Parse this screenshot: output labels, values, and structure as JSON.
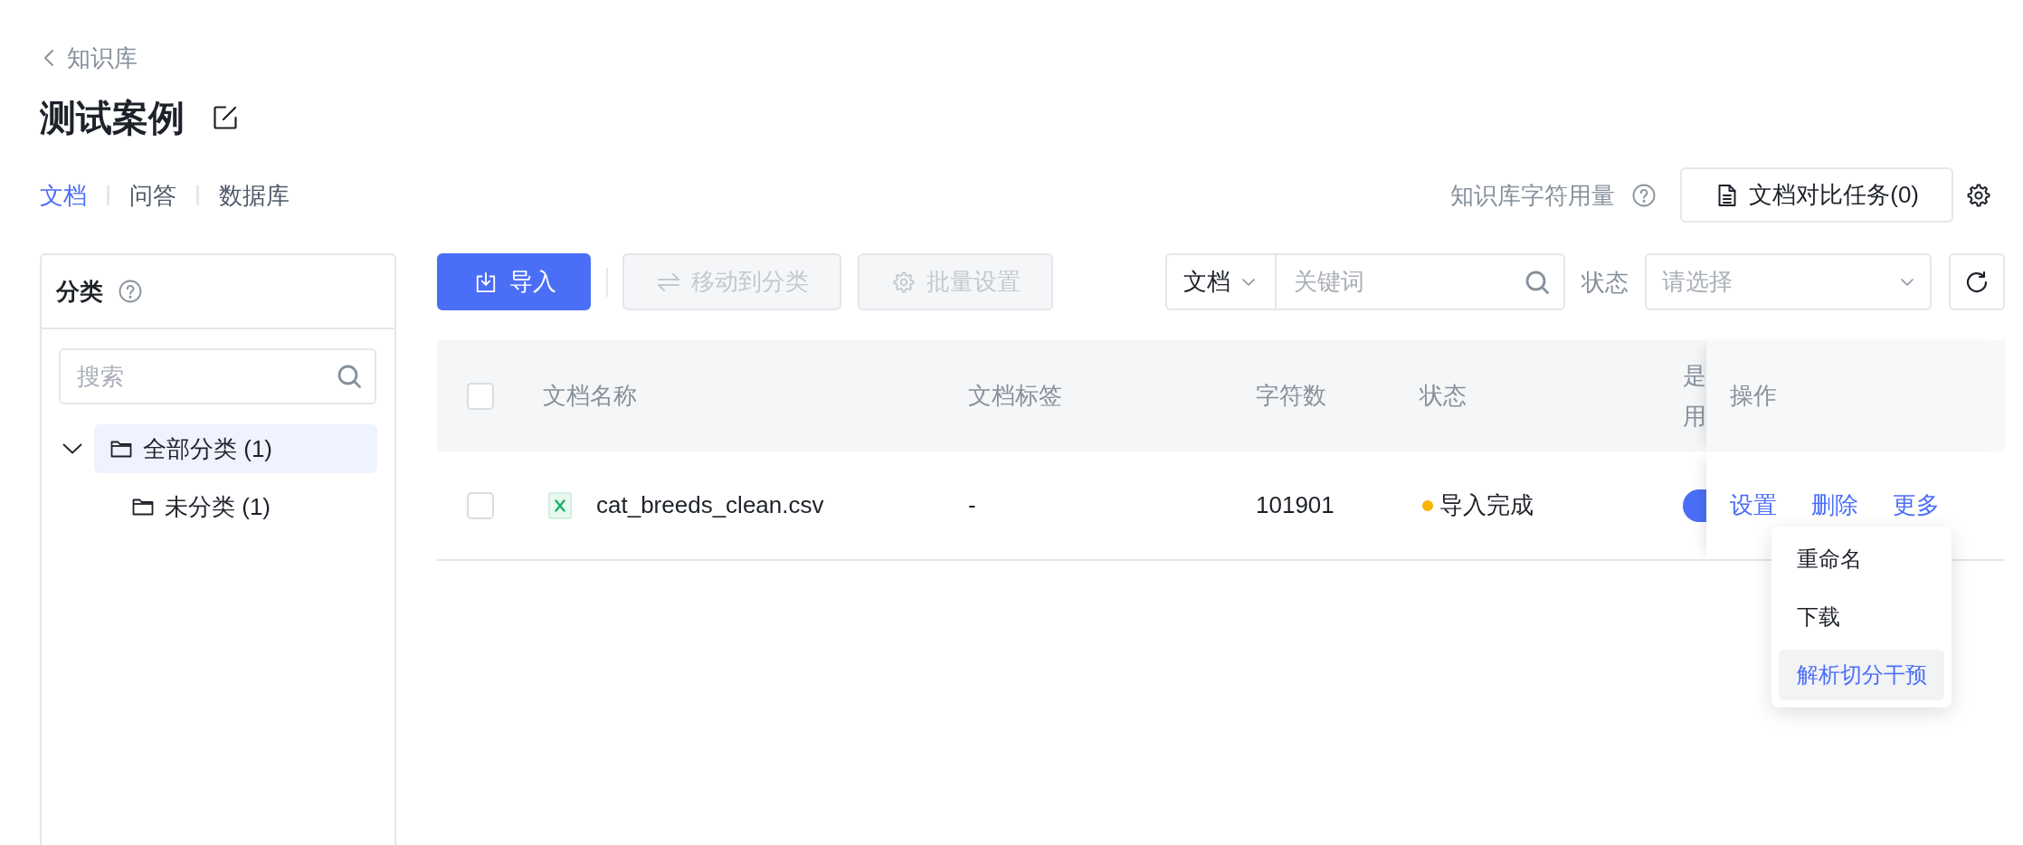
{
  "breadcrumb": {
    "label": "知识库"
  },
  "title": "测试案例",
  "tabs": [
    {
      "label": "文档",
      "selected": true
    },
    {
      "label": "问答",
      "selected": false
    },
    {
      "label": "数据库",
      "selected": false
    }
  ],
  "usage": {
    "label": "知识库字符用量"
  },
  "compare_button": {
    "label": "文档对比任务(0)"
  },
  "sidebar": {
    "title": "分类",
    "search": {
      "placeholder": "搜索"
    },
    "tree": [
      {
        "label": "全部分类 (1)",
        "expanded": true,
        "selected": true,
        "children": [
          {
            "label": "未分类 (1)",
            "selected": false
          }
        ]
      }
    ]
  },
  "toolbar": {
    "buttons": [
      {
        "kind": "primary",
        "label": "导入",
        "disabled": false
      },
      {
        "kind": "move",
        "label": "移动到分类",
        "disabled": true
      },
      {
        "kind": "settings",
        "label": "批量设置",
        "disabled": true
      }
    ],
    "scope_select": {
      "value": "文档"
    },
    "keyword": {
      "placeholder": "关键词"
    },
    "status_filter": {
      "label": "状态",
      "placeholder": "请选择"
    }
  },
  "table": {
    "select_all": {
      "checked": false
    },
    "columns": [
      "文档名称",
      "文档标签",
      "字符数",
      "状态",
      "是用",
      "操作"
    ],
    "rows": [
      {
        "checked": false,
        "name": "cat_breeds_clean.csv",
        "tags": "-",
        "chars": "101901",
        "status": {
          "label": "导入完成",
          "color": "#f7b500"
        },
        "enabled": true,
        "actions": [
          "设置",
          "删除",
          "更多"
        ]
      }
    ]
  },
  "more_menu": {
    "items": [
      {
        "label": "重命名",
        "selected": false
      },
      {
        "label": "下载",
        "selected": false
      },
      {
        "label": "解析切分干预",
        "selected": true
      }
    ]
  }
}
